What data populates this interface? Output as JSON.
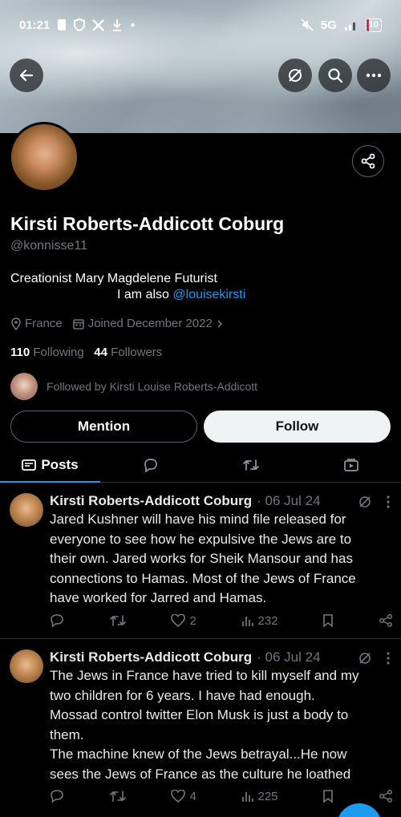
{
  "status_bar": {
    "time": "01:21",
    "network": "5G",
    "battery": "10"
  },
  "profile": {
    "name": "Kirsti Roberts-Addicott Coburg",
    "handle": "@konnisse11",
    "bio_line1": "Creationist Mary Magdelene Futurist",
    "bio_line2_prefix": "I am also",
    "bio_link": "@louisekirsti",
    "location": "France",
    "joined": "Joined December 2022",
    "following_count": "110",
    "following_label": "Following",
    "followers_count": "44",
    "followers_label": "Followers",
    "followed_by": "Followed by Kirsti Louise Roberts-Addicott"
  },
  "buttons": {
    "mention": "Mention",
    "follow": "Follow"
  },
  "tabs": [
    {
      "label": "Posts",
      "icon": "posts-icon"
    },
    {
      "label": "",
      "icon": "replies-icon"
    },
    {
      "label": "",
      "icon": "reposts-icon"
    },
    {
      "label": "",
      "icon": "media-icon"
    }
  ],
  "posts": [
    {
      "author": "Kirsti Roberts-Addicott Coburg",
      "date": "· 06 Jul 24",
      "lines": [
        "Jared Kushner will have his mind file released for",
        "everyone to see how he expulsive the Jews are to",
        "their own.  Jared works for Sheik Mansour and has",
        "connections to Hamas.  Most of the Jews of France",
        "have worked for Jarred and Hamas."
      ],
      "likes": "2",
      "views": "232"
    },
    {
      "author": "Kirsti Roberts-Addicott Coburg",
      "date": "· 06 Jul 24",
      "lines": [
        "The Jews in France have tried to kill myself and my",
        "two children for 6 years.  I have had enough.",
        "Mossad control twitter Elon Musk is just a body to",
        "them.",
        "The machine knew of the Jews  betrayal...He now",
        "sees the Jews of France as the culture he loathed"
      ],
      "likes": "4",
      "views": "225"
    }
  ],
  "colors": {
    "accent": "#1d9bf0",
    "muted": "#71767b",
    "background": "#000000"
  }
}
